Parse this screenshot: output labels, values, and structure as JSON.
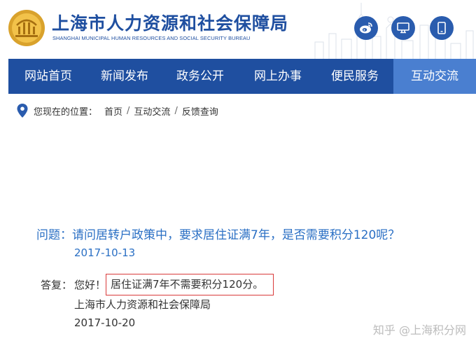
{
  "header": {
    "title": "上海市人力资源和社会保障局",
    "subtitle": "SHANGHAI MUNICIPAL HUMAN RESOURCES AND SOCIAL SECURITY BUREAU",
    "social_icons": [
      "weibo-icon",
      "desktop-icon",
      "mobile-icon"
    ]
  },
  "nav": {
    "items": [
      "网站首页",
      "新闻发布",
      "政务公开",
      "网上办事",
      "便民服务",
      "互动交流"
    ],
    "active_index": 5
  },
  "breadcrumb": {
    "label": "您现在的位置：",
    "items": [
      "首页",
      "互动交流",
      "反馈查询"
    ],
    "separator": "/"
  },
  "qa": {
    "question": "问题：请问居转户政策中，要求居住证满7年，是否需要积分120呢？",
    "question_date": "2017-10-13",
    "answer_label": "答复：",
    "answer_greeting": "您好！",
    "answer_highlight": "居住证满7年不需要积分120分。",
    "answer_org": "上海市人力资源和社会保障局",
    "answer_date": "2017-10-20"
  },
  "watermark": "知乎 @上海积分网",
  "colors": {
    "brand_blue": "#1f4fa0",
    "nav_active": "#4a7fd0",
    "link_blue": "#2a6fc4",
    "highlight_border": "#d93a3a"
  }
}
